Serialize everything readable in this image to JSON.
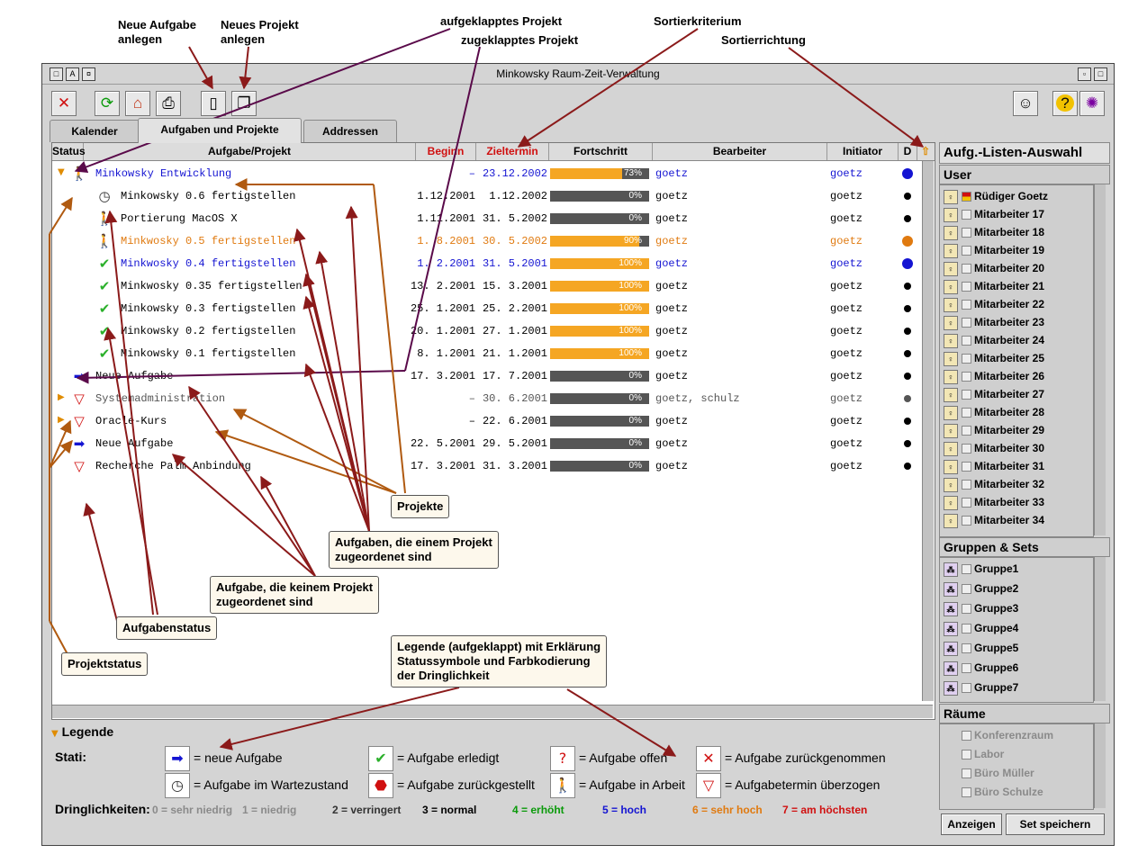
{
  "callouts": {
    "new_task": "Neue Aufgabe\nanlegen",
    "new_project": "Neues Projekt\nanlegen",
    "expanded_project": "aufgeklapptes Projekt",
    "collapsed_project": "zugeklapptes Projekt",
    "sort_criterion": "Sortierkriterium",
    "sort_direction": "Sortierrichtung",
    "projects": "Projekte",
    "tasks_in_project": "Aufgaben, die einem Projekt\nzugeordenet sind",
    "tasks_no_project": "Aufgabe, die keinem Projekt\nzugeordenet sind",
    "task_status": "Aufgabenstatus",
    "project_status": "Projektstatus",
    "legend_note": "Legende (aufgeklappt) mit Erklärung\nStatussymbole und Farbkodierung\nder Dringlichkeit"
  },
  "window": {
    "title": "Minkowsky Raum-Zeit-Verwaltung"
  },
  "tabs": [
    {
      "label": "Kalender"
    },
    {
      "label": "Aufgaben und Projekte"
    },
    {
      "label": "Addressen"
    }
  ],
  "columns": {
    "status": "Status",
    "task": "Aufgabe/Projekt",
    "begin": "Beginn",
    "deadline": "Zieltermin",
    "progress": "Fortschritt",
    "assignee": "Bearbeiter",
    "initiator": "Initiator",
    "d": "D"
  },
  "colors": {
    "blue": "#1414d2",
    "orange": "#e07a10",
    "red": "#d01010",
    "progress": "#f5a623"
  },
  "rows": [
    {
      "kind": "project-open",
      "icon": "walker",
      "name": "Minkowsky Entwicklung",
      "begin": "–",
      "deadline": "23.12.2002",
      "progress": 73,
      "progress_label": "73%",
      "assignee": "goetz",
      "initiator": "goetz",
      "dot": "#1414d2",
      "color": "#1414d2"
    },
    {
      "kind": "task",
      "icon": "clock",
      "name": "Minkowsky 0.6 fertigstellen",
      "begin": "1.12.2001",
      "deadline": "1.12.2002",
      "progress": 0,
      "progress_label": "0%",
      "assignee": "goetz",
      "initiator": "goetz",
      "dot": "#000000",
      "color": "#000000"
    },
    {
      "kind": "task",
      "icon": "walker",
      "name": "Portierung MacOS X",
      "begin": "1.11.2001",
      "deadline": "31. 5.2002",
      "progress": 0,
      "progress_label": "0%",
      "assignee": "goetz",
      "initiator": "goetz",
      "dot": "#000000",
      "color": "#000000"
    },
    {
      "kind": "task",
      "icon": "walker",
      "name": "Minkwosky 0.5 fertigstellen",
      "begin": "1. 8.2001",
      "deadline": "30. 5.2002",
      "progress": 90,
      "progress_label": "90%",
      "assignee": "goetz",
      "initiator": "goetz",
      "dot": "#e07a10",
      "color": "#e07a10"
    },
    {
      "kind": "task",
      "icon": "check",
      "name": "Minkwosky 0.4 fertigstellen",
      "begin": "1. 2.2001",
      "deadline": "31. 5.2001",
      "progress": 100,
      "progress_label": "100%",
      "assignee": "goetz",
      "initiator": "goetz",
      "dot": "#1414d2",
      "color": "#1414d2"
    },
    {
      "kind": "task",
      "icon": "check",
      "name": "Minkwosky 0.35 fertigstellen",
      "begin": "13. 2.2001",
      "deadline": "15. 3.2001",
      "progress": 100,
      "progress_label": "100%",
      "assignee": "goetz",
      "initiator": "goetz",
      "dot": "#000000",
      "color": "#000000"
    },
    {
      "kind": "task",
      "icon": "check",
      "name": "Minkowsky 0.3 fertigstellen",
      "begin": "25. 1.2001",
      "deadline": "25. 2.2001",
      "progress": 100,
      "progress_label": "100%",
      "assignee": "goetz",
      "initiator": "goetz",
      "dot": "#000000",
      "color": "#000000"
    },
    {
      "kind": "task",
      "icon": "check",
      "name": "Minkowsky 0.2 fertigstellen",
      "begin": "20. 1.2001",
      "deadline": "27. 1.2001",
      "progress": 100,
      "progress_label": "100%",
      "assignee": "goetz",
      "initiator": "goetz",
      "dot": "#000000",
      "color": "#000000"
    },
    {
      "kind": "task",
      "icon": "check",
      "name": "Minkowsky 0.1 fertigstellen",
      "begin": "8. 1.2001",
      "deadline": "21. 1.2001",
      "progress": 100,
      "progress_label": "100%",
      "assignee": "goetz",
      "initiator": "goetz",
      "dot": "#000000",
      "color": "#000000"
    },
    {
      "kind": "top-task",
      "icon": "arrow",
      "name": "Neue Aufgabe",
      "begin": "17. 3.2001",
      "deadline": "17. 7.2001",
      "progress": 0,
      "progress_label": "0%",
      "assignee": "goetz",
      "initiator": "goetz",
      "dot": "#000000",
      "color": "#000000"
    },
    {
      "kind": "project-closed",
      "icon": "warn",
      "name": "Systemadministration",
      "begin": "–",
      "deadline": "30. 6.2001",
      "progress": 0,
      "progress_label": "0%",
      "assignee": "goetz, schulz",
      "initiator": "goetz",
      "dot": "#555555",
      "color": "#555555"
    },
    {
      "kind": "project-closed",
      "icon": "warn",
      "name": "Oracle-Kurs",
      "begin": "–",
      "deadline": "22. 6.2001",
      "progress": 0,
      "progress_label": "0%",
      "assignee": "goetz",
      "initiator": "goetz",
      "dot": "#000000",
      "color": "#000000"
    },
    {
      "kind": "top-task",
      "icon": "arrow",
      "name": "Neue Aufgabe",
      "begin": "22. 5.2001",
      "deadline": "29. 5.2001",
      "progress": 0,
      "progress_label": "0%",
      "assignee": "goetz",
      "initiator": "goetz",
      "dot": "#000000",
      "color": "#000000"
    },
    {
      "kind": "top-task",
      "icon": "warn",
      "name": "Recherche Palm Anbindung",
      "begin": "17. 3.2001",
      "deadline": "31. 3.2001",
      "progress": 0,
      "progress_label": "0%",
      "assignee": "goetz",
      "initiator": "goetz",
      "dot": "#000000",
      "color": "#000000"
    }
  ],
  "sidebar": {
    "title": "Aufg.-Listen-Auswahl",
    "user_header": "User",
    "users": [
      "Rüdiger Goetz",
      "Mitarbeiter 17",
      "Mitarbeiter 18",
      "Mitarbeiter 19",
      "Mitarbeiter 20",
      "Mitarbeiter 21",
      "Mitarbeiter 22",
      "Mitarbeiter 23",
      "Mitarbeiter 24",
      "Mitarbeiter 25",
      "Mitarbeiter 26",
      "Mitarbeiter 27",
      "Mitarbeiter 28",
      "Mitarbeiter 29",
      "Mitarbeiter 30",
      "Mitarbeiter 31",
      "Mitarbeiter 32",
      "Mitarbeiter 33",
      "Mitarbeiter 34"
    ],
    "groups_header": "Gruppen & Sets",
    "groups": [
      "Gruppe1",
      "Gruppe2",
      "Gruppe3",
      "Gruppe4",
      "Gruppe5",
      "Gruppe6",
      "Gruppe7"
    ],
    "rooms_header": "Räume",
    "rooms": [
      "Konferenzraum",
      "Labor",
      "Büro Müller",
      "Büro Schulze"
    ],
    "show_button": "Anzeigen",
    "save_button": "Set speichern"
  },
  "legend": {
    "title": "Legende",
    "stati_label": "Stati:",
    "items": [
      {
        "icon": "arrow",
        "text": "= neue Aufgabe"
      },
      {
        "icon": "check",
        "text": "= Aufgabe  erledigt"
      },
      {
        "icon": "question",
        "text": "= Aufgabe offen"
      },
      {
        "icon": "cross",
        "text": "= Aufgabe zurückgenommen"
      },
      {
        "icon": "clock",
        "text": "= Aufgabe im Wartezustand"
      },
      {
        "icon": "stop",
        "text": "= Aufgabe zurückgestellt"
      },
      {
        "icon": "walker",
        "text": "= Aufgabe in Arbeit"
      },
      {
        "icon": "warn",
        "text": "= Aufgabetermin überzogen"
      }
    ],
    "urgency_label": "Dringlichkeiten:",
    "urgencies": [
      {
        "text": "0 = sehr niedrig",
        "color": "#8a8a8a"
      },
      {
        "text": "1 = niedrig",
        "color": "#8a8a8a"
      },
      {
        "text": "2 = verringert",
        "color": "#333333"
      },
      {
        "text": "3 = normal",
        "color": "#000000"
      },
      {
        "text": "4 = erhöht",
        "color": "#0a9a0a"
      },
      {
        "text": "5 = hoch",
        "color": "#1414d2"
      },
      {
        "text": "6 = sehr hoch",
        "color": "#e07a10"
      },
      {
        "text": "7 = am höchsten",
        "color": "#d01010"
      }
    ]
  }
}
